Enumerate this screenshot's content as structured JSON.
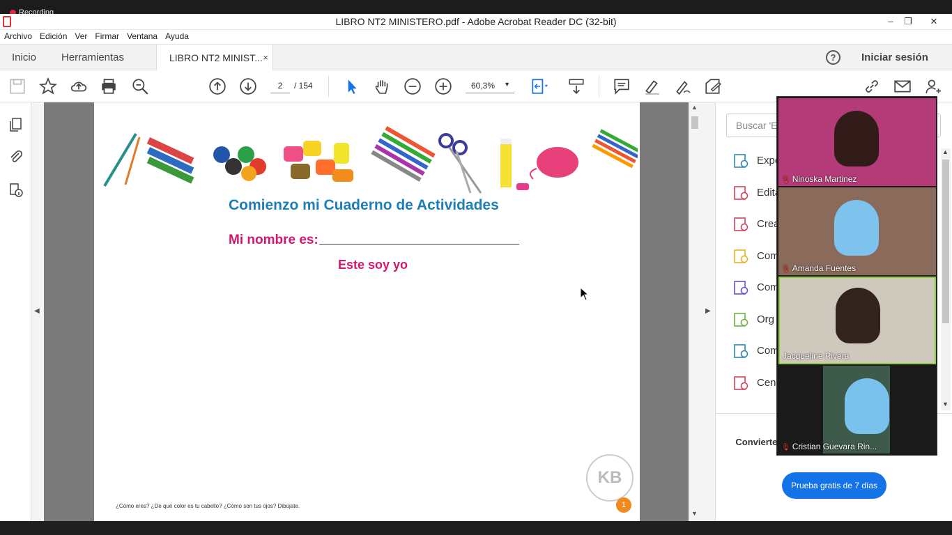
{
  "recording": {
    "label": "Recording"
  },
  "window": {
    "title": "LIBRO NT2 MINISTERO.pdf - Adobe Acrobat Reader DC (32-bit)",
    "minimize": "–",
    "restore": "❐",
    "close": "✕"
  },
  "menu": [
    "Archivo",
    "Edición",
    "Ver",
    "Firmar",
    "Ventana",
    "Ayuda"
  ],
  "tabs": {
    "home": "Inicio",
    "tools": "Herramientas",
    "document": "LIBRO NT2 MINIST...",
    "document_close": "×"
  },
  "header": {
    "help": "?",
    "signin": "Iniciar sesión"
  },
  "toolbar": {
    "page_current": "2",
    "page_total": "/ 154",
    "zoom": "60,3%"
  },
  "document": {
    "heading": "Comienzo mi Cuaderno de Actividades",
    "name_label": "Mi nombre es:",
    "este_soy_yo": "Este soy yo",
    "footer_question": "¿Cómo eres? ¿De qué color es tu cabello? ¿Cómo son tus ojos? Dibújate.",
    "page_number": "1",
    "seal_text": "KB"
  },
  "right_panel": {
    "search_placeholder": "Buscar 'Ex",
    "tools": [
      {
        "label": "Expo",
        "icon": "export-pdf-icon",
        "color": "#2b8ab0"
      },
      {
        "label": "Edita",
        "icon": "edit-pdf-icon",
        "color": "#d2425c"
      },
      {
        "label": "Crea",
        "icon": "create-pdf-icon",
        "color": "#d2425c"
      },
      {
        "label": "Com",
        "icon": "comment-icon",
        "color": "#e8b321"
      },
      {
        "label": "Com",
        "icon": "combine-files-icon",
        "color": "#6c4ed8"
      },
      {
        "label": "Org",
        "icon": "organize-pages-icon",
        "color": "#6fb23a"
      },
      {
        "label": "Com",
        "icon": "compress-pdf-icon",
        "color": "#2b8ab0"
      },
      {
        "label": "Cens",
        "icon": "redact-icon",
        "color": "#d2425c"
      }
    ],
    "promo": "Convierte y edita formularios y contratos PDF",
    "trial_button": "Prueba gratis de 7 días"
  },
  "participants": [
    {
      "name": "Ninoska Martinez",
      "muted": true,
      "bg": "#b53a78"
    },
    {
      "name": "Amanda Fuentes",
      "muted": true,
      "bg": "#8a6a5a"
    },
    {
      "name": "Jacqueline Rivera",
      "muted": false,
      "bg": "#cfc8bd"
    },
    {
      "name": "Cristian Guevara Rin...",
      "muted": true,
      "bg": "#3d5a4a"
    }
  ]
}
